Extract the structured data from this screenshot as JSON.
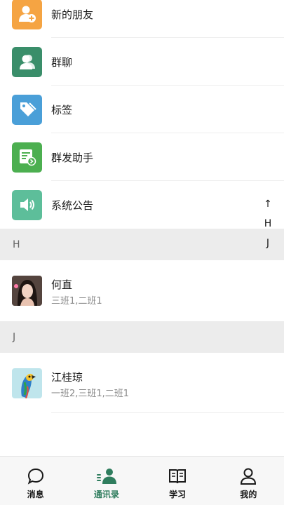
{
  "functions": [
    {
      "label": "新的朋友",
      "icon": "add-friend-icon",
      "color": "#F5A443"
    },
    {
      "label": "群聊",
      "icon": "group-chat-icon",
      "color": "#3A8E6A"
    },
    {
      "label": "标签",
      "icon": "tag-icon",
      "color": "#4A9FD8"
    },
    {
      "label": "群发助手",
      "icon": "broadcast-icon",
      "color": "#4CAF50"
    },
    {
      "label": "系统公告",
      "icon": "speaker-icon",
      "color": "#5DBE9A"
    }
  ],
  "sections": [
    {
      "letter": "H",
      "contacts": [
        {
          "name": "何直",
          "classes": "三班1,二班1",
          "avatar": "avatar-woman"
        }
      ]
    },
    {
      "letter": "J",
      "contacts": [
        {
          "name": "江桂琼",
          "classes": "一班2,三班1,二班1",
          "avatar": "avatar-parrot"
        }
      ]
    }
  ],
  "index_bar": [
    "↑",
    "H",
    "J"
  ],
  "tabs": [
    {
      "label": "消息",
      "icon": "chat-bubble-icon",
      "active": false
    },
    {
      "label": "通讯录",
      "icon": "contacts-icon",
      "active": true
    },
    {
      "label": "学习",
      "icon": "book-icon",
      "active": false
    },
    {
      "label": "我的",
      "icon": "person-icon",
      "active": false
    }
  ],
  "colors": {
    "accent": "#2F7D5E",
    "section_bg": "#ECECEC"
  }
}
